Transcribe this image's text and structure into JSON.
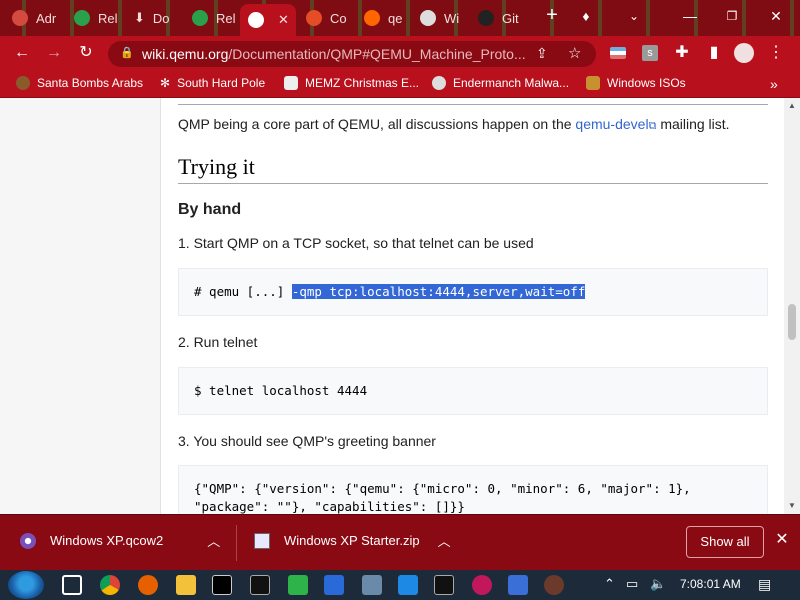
{
  "browser": {
    "tabs": [
      {
        "label": "Adr",
        "color": "#d34a3f"
      },
      {
        "label": "Rel",
        "color": "#2aa04a"
      },
      {
        "label": "Do",
        "color": "#ffffff"
      },
      {
        "label": "Rel",
        "color": "#2aa04a"
      },
      {
        "label": "",
        "color": "#ffffff"
      },
      {
        "label": "Co",
        "color": "#e44d26"
      },
      {
        "label": "qe",
        "color": "#ff6600"
      },
      {
        "label": "Wi",
        "color": "#dddddd"
      },
      {
        "label": "Git",
        "color": "#222222"
      }
    ],
    "url_domain": "wiki.qemu.org",
    "url_path": "/Documentation/QMP#QEMU_Machine_Proto...",
    "bookmarks": [
      "Santa Bombs Arabs",
      "South Hard Pole",
      "MEMZ Christmas E...",
      "Endermanch Malwa...",
      "Windows ISOs"
    ],
    "theme": {
      "tabbar": "#7e0c12",
      "toolbar": "#b8101c"
    }
  },
  "article": {
    "intro_text": "QMP being a core part of QEMU, all discussions happen on the",
    "intro_link": "qemu-devel",
    "intro_tail": "mailing list.",
    "section_title": "Trying it",
    "subsection_title": "By hand",
    "step1": "1. Start QMP on a TCP socket, so that telnet can be used",
    "code1_plain": "# qemu [...] ",
    "code1_selected": "-qmp tcp:localhost:4444,server,wait=off",
    "step2": "2. Run telnet",
    "code2": "$ telnet localhost 4444",
    "step3": "3. You should see QMP's greeting banner",
    "code3_line1": "{\"QMP\": {\"version\": {\"qemu\": {\"micro\": 0, \"minor\": 6, \"major\": 1},",
    "code3_line2": "\"package\": \"\"}, \"capabilities\": []}}"
  },
  "downloads": {
    "items": [
      {
        "name": "Windows XP.qcow2"
      },
      {
        "name": "Windows XP Starter.zip"
      }
    ],
    "show_all": "Show all"
  },
  "taskbar": {
    "clock": "7:08:01 AM"
  }
}
